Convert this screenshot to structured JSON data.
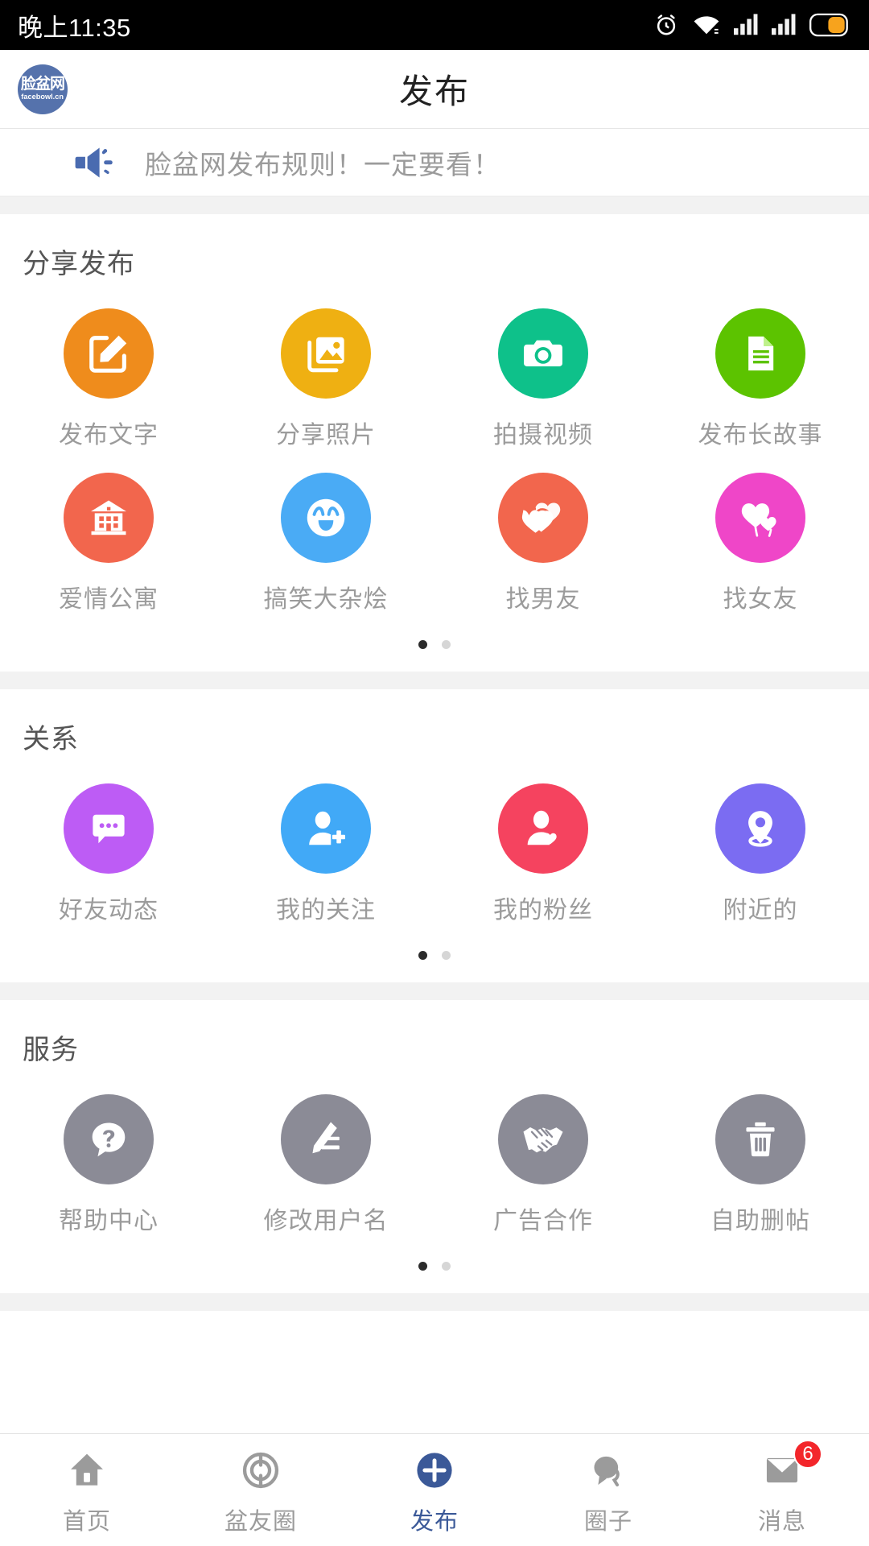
{
  "status_bar": {
    "time": "晚上11:35",
    "icons": [
      "alarm-icon",
      "wifi-icon",
      "signal-1-icon",
      "signal-2-icon",
      "battery-icon"
    ]
  },
  "header": {
    "title": "发布",
    "logo_line1": "脸盆网",
    "logo_line2": "facebowl.cn",
    "logo_color": "#5572ac"
  },
  "notice": {
    "icon": "megaphone-icon",
    "text": "脸盆网发布规则！一定要看！",
    "icon_color": "#4a6bb0"
  },
  "sections": [
    {
      "title": "分享发布",
      "items": [
        {
          "label": "发布文字",
          "icon": "edit-square-icon",
          "color": "#ef8c1c"
        },
        {
          "label": "分享照片",
          "icon": "photos-icon",
          "color": "#efb012"
        },
        {
          "label": "拍摄视频",
          "icon": "camera-icon",
          "color": "#0ec18a"
        },
        {
          "label": "发布长故事",
          "icon": "document-icon",
          "color": "#5cc300"
        },
        {
          "label": "爱情公寓",
          "icon": "building-icon",
          "color": "#f2664d"
        },
        {
          "label": "搞笑大杂烩",
          "icon": "laughing-face-icon",
          "color": "#4aabf5"
        },
        {
          "label": "找男友",
          "icon": "double-heart-icon",
          "color": "#f2664d"
        },
        {
          "label": "找女友",
          "icon": "heart-balloon-icon",
          "color": "#ef46c8"
        }
      ],
      "pages": 2,
      "current_page": 1
    },
    {
      "title": "关系",
      "items": [
        {
          "label": "好友动态",
          "icon": "chat-bubble-icon",
          "color": "#bd5cf5"
        },
        {
          "label": "我的关注",
          "icon": "user-add-icon",
          "color": "#41a9f7"
        },
        {
          "label": "我的粉丝",
          "icon": "user-heart-icon",
          "color": "#f5435f"
        },
        {
          "label": "附近的",
          "icon": "location-pin-icon",
          "color": "#7b6cf2"
        }
      ],
      "pages": 2,
      "current_page": 1
    },
    {
      "title": "服务",
      "items": [
        {
          "label": "帮助中心",
          "icon": "question-bubble-icon",
          "color": "#8b8b96"
        },
        {
          "label": "修改用户名",
          "icon": "pencil-edit-icon",
          "color": "#8b8b96"
        },
        {
          "label": "广告合作",
          "icon": "handshake-icon",
          "color": "#8b8b96"
        },
        {
          "label": "自助删帖",
          "icon": "trash-icon",
          "color": "#8b8b96"
        }
      ],
      "pages": 2,
      "current_page": 1
    }
  ],
  "tabbar": {
    "active_color": "#3b5998",
    "inactive_color": "#9b9b9b",
    "items": [
      {
        "label": "首页",
        "icon": "home-icon",
        "active": false,
        "badge": ""
      },
      {
        "label": "盆友圈",
        "icon": "compass-icon",
        "active": false,
        "badge": ""
      },
      {
        "label": "发布",
        "icon": "plus-icon",
        "active": true,
        "badge": ""
      },
      {
        "label": "圈子",
        "icon": "speech-icon",
        "active": false,
        "badge": ""
      },
      {
        "label": "消息",
        "icon": "envelope-icon",
        "active": false,
        "badge": "6"
      }
    ]
  }
}
